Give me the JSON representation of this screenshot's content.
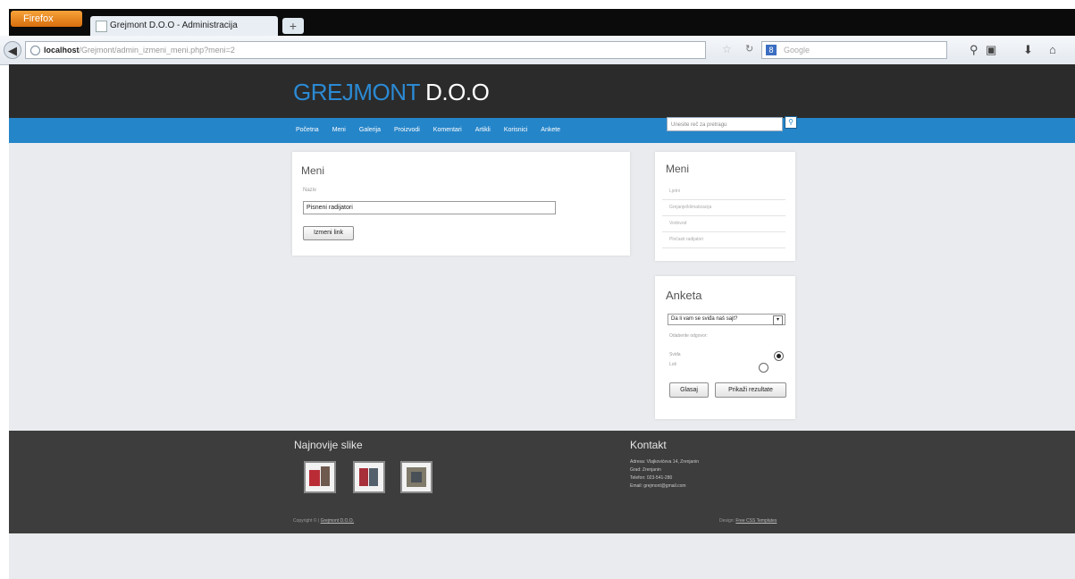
{
  "browser": {
    "app_button": "Firefox",
    "tab_title": "Grejmont D.O.O - Administracija",
    "new_tab": "+",
    "url_host": "localhost",
    "url_path": "/Grejmont/admin_izmeni_meni.php?meni=2",
    "search_engine": "Google",
    "search_placeholder": "Google"
  },
  "site": {
    "logo_part1": "GREJMONT",
    "logo_part2": "D.O.O",
    "nav": [
      "Početna",
      "Meni",
      "Galerija",
      "Proizvodi",
      "Komentari",
      "Artikli",
      "Korisnici",
      "Ankete"
    ],
    "search_placeholder": "Unesite reč za pretragu"
  },
  "main": {
    "title": "Meni",
    "field_label": "Naziv",
    "field_value": "Pisneni radijatori",
    "submit_label": "Izmeni link"
  },
  "side_menu": {
    "title": "Meni",
    "links": [
      "Ljetni",
      "Grejanje/klimatizacija",
      "Vodovod",
      "Pločasti radijatori"
    ]
  },
  "poll": {
    "title": "Anketa",
    "question": "Da li vam se sviđa naš sajt?",
    "prompt": "Odaberite odgovor:",
    "options": [
      {
        "label": "Sviđa",
        "selected": true
      },
      {
        "label": "Loš",
        "selected": false
      }
    ],
    "vote_label": "Glasaj",
    "results_label": "Prikaži rezultate"
  },
  "footer": {
    "gallery_title": "Najnovije slike",
    "contact_title": "Kontakt",
    "contact_lines": [
      "Adresa: Vlajkovićeva 14, Zrenjanin",
      "Grad: Zrenjanin",
      "Telefon: 023-541-280",
      "Email: grejmont@gmail.com"
    ],
    "copyright_prefix": "Copyright © |",
    "copyright_link": "Grejmont D.O.O.",
    "design_prefix": "Design:",
    "design_link": "Free CSS Templates"
  },
  "colors": {
    "accent": "#2585c9",
    "header_bg": "#2b2b2b",
    "footer_bg": "#3d3d3d",
    "page_bg": "#e9ebee"
  }
}
